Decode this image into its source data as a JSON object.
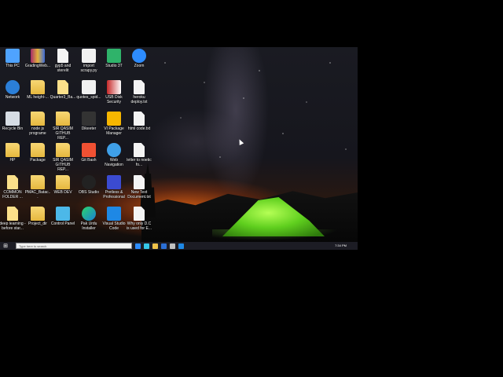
{
  "desktop": {
    "icons": [
      {
        "label": "This PC",
        "icon": "pc-icon",
        "kind": "pc"
      },
      {
        "label": "GradingWeb...",
        "icon": "winrar-archive-icon",
        "kind": "winrar"
      },
      {
        "label": "gyp5 and sterelit",
        "icon": "text-document-icon",
        "kind": "doc"
      },
      {
        "label": "import scrapy.py",
        "icon": "python-file-icon",
        "kind": "py"
      },
      {
        "label": "Studio 3T",
        "icon": "studio3t-icon",
        "kind": "s3t"
      },
      {
        "label": "Zoom",
        "icon": "zoom-icon",
        "kind": "zoom"
      },
      {
        "label": "Network",
        "icon": "network-icon",
        "kind": "network"
      },
      {
        "label": "ML height-...",
        "icon": "folder-icon",
        "kind": "folder"
      },
      {
        "label": "Quarter3_Ba...",
        "icon": "document-icon",
        "kind": "docy"
      },
      {
        "label": "quotes_spid...",
        "icon": "python-file-icon",
        "kind": "py"
      },
      {
        "label": "USB Disk Security",
        "icon": "shield-icon",
        "kind": "shield"
      },
      {
        "label": "heroku deploy.txt",
        "icon": "text-document-icon",
        "kind": "doc"
      },
      {
        "label": "Recycle Bin",
        "icon": "recycle-bin-icon",
        "kind": "bin"
      },
      {
        "label": "node js programe",
        "icon": "folder-icon",
        "kind": "folder"
      },
      {
        "label": "SIR QASIM GITHUB REP...",
        "icon": "folder-icon",
        "kind": "folder"
      },
      {
        "label": "Dikeeter",
        "icon": "app-icon",
        "kind": "dark"
      },
      {
        "label": "VI Package Manager",
        "icon": "vi-package-icon",
        "kind": "vi"
      },
      {
        "label": "html code.txt",
        "icon": "text-document-icon",
        "kind": "doc"
      },
      {
        "label": "HP",
        "icon": "user-folder-icon",
        "kind": "folder"
      },
      {
        "label": "Package",
        "icon": "folder-icon",
        "kind": "folder"
      },
      {
        "label": "SIR QASIM GITHUB REP...",
        "icon": "folder-icon",
        "kind": "folder"
      },
      {
        "label": "Git Bash",
        "icon": "git-bash-icon",
        "kind": "git"
      },
      {
        "label": "Web Navigation",
        "icon": "globe-icon",
        "kind": "globe"
      },
      {
        "label": "letter to noetic fo...",
        "icon": "text-document-icon",
        "kind": "doc"
      },
      {
        "label": "COMMON FOLDER ...",
        "icon": "folder-icon",
        "kind": "docy"
      },
      {
        "label": "PMAC_Batac...",
        "icon": "folder-icon",
        "kind": "folder"
      },
      {
        "label": "WEB DEV",
        "icon": "folder-icon",
        "kind": "folder"
      },
      {
        "label": "OBS Studio",
        "icon": "obs-icon",
        "kind": "obs"
      },
      {
        "label": "Pretless & Professional",
        "icon": "app-icon",
        "kind": "app"
      },
      {
        "label": "New Text Document.txt",
        "icon": "text-document-icon",
        "kind": "doc"
      },
      {
        "label": "deep learning - before star...",
        "icon": "folder-icon",
        "kind": "docy"
      },
      {
        "label": "Project_dir",
        "icon": "folder-icon",
        "kind": "folder"
      },
      {
        "label": "Control Panel",
        "icon": "control-panel-icon",
        "kind": "cp"
      },
      {
        "label": "Pak Urdu Installer",
        "icon": "edge-icon",
        "kind": "edge"
      },
      {
        "label": "Visual Studio Code",
        "icon": "vscode-icon",
        "kind": "vscode"
      },
      {
        "label": "Why only D.C is used for E...",
        "icon": "text-document-icon",
        "kind": "doc"
      }
    ]
  },
  "taskbar": {
    "search_placeholder": "Type here to search",
    "time": "7:34 PM"
  },
  "colors": {
    "accent": "#2d8cff",
    "folder": "#e6b83e",
    "tent": "#5fcf1e"
  }
}
